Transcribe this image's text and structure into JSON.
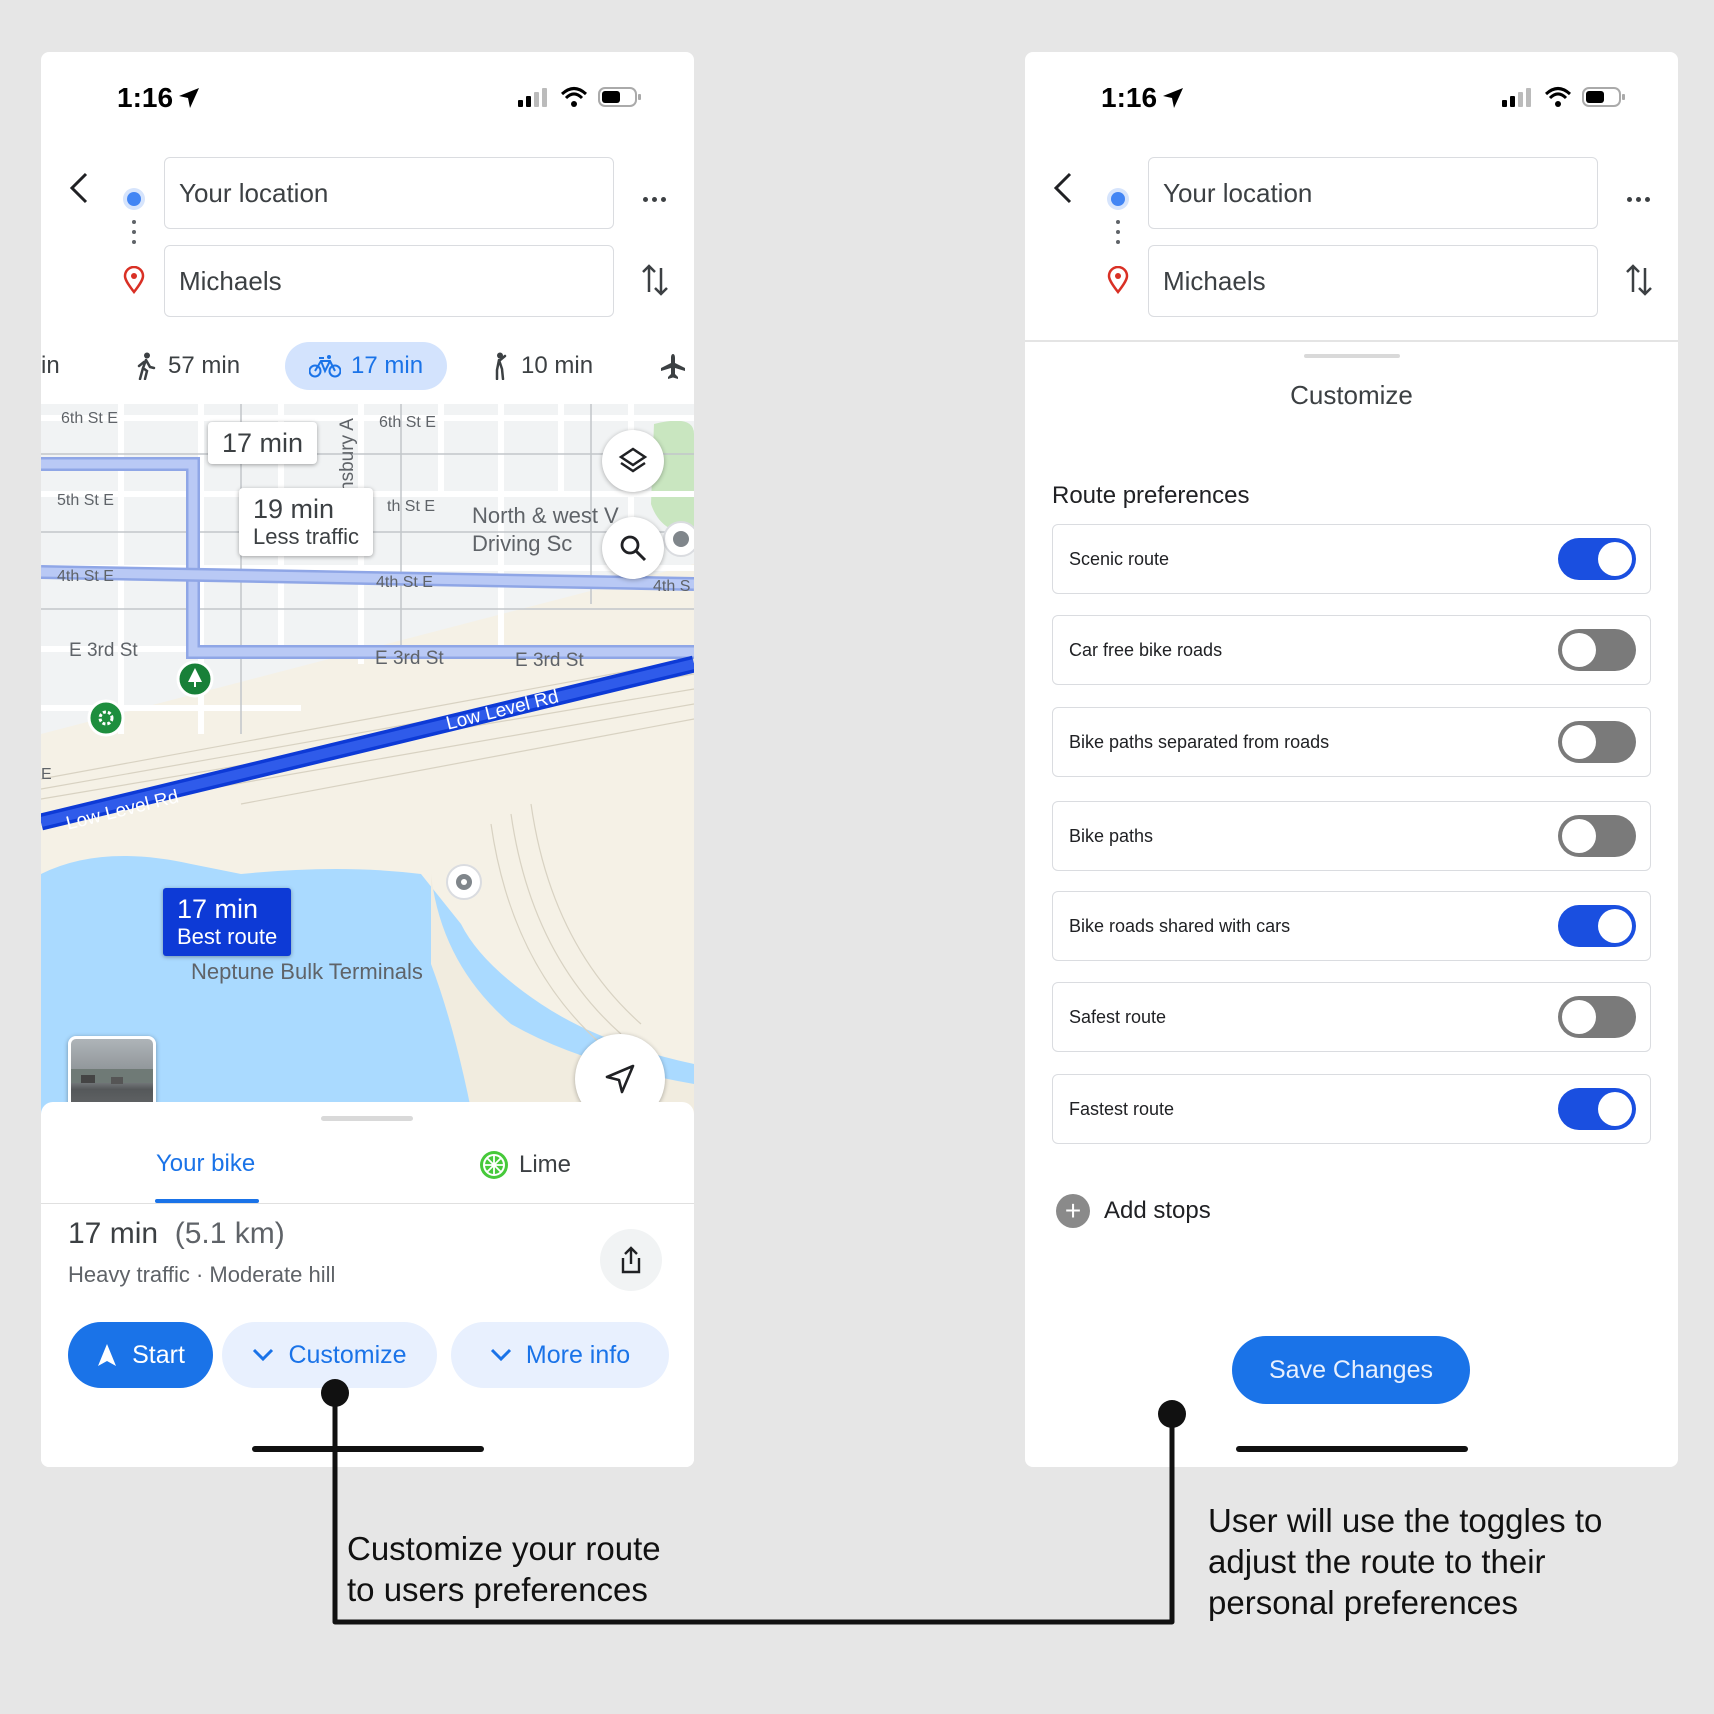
{
  "status_bar": {
    "time": "1:16"
  },
  "left_screen": {
    "origin": "Your location",
    "destination": "Michaels",
    "modes": [
      {
        "label": "in",
        "icon": "car-icon"
      },
      {
        "label": "57 min",
        "icon": "walk-icon"
      },
      {
        "label": "17 min",
        "icon": "bike-icon",
        "active": true
      },
      {
        "label": "10 min",
        "icon": "rideshare-icon"
      },
      {
        "label": "",
        "icon": "flight-icon"
      }
    ],
    "map": {
      "streets": [
        "6th St E",
        "6th St E",
        "5th St E",
        "th St E",
        "4th St E",
        "4th St E",
        "4th S",
        "E 3rd St",
        "E 3rd St",
        "E 3rd St",
        "Low Level Rd",
        "Low Level Rd",
        "nsbury A",
        "E"
      ],
      "callouts": [
        {
          "title": "17 min",
          "subtitle": ""
        },
        {
          "title": "19 min",
          "subtitle": "Less traffic"
        },
        {
          "title": "17 min",
          "subtitle": "Best route"
        }
      ],
      "poi_driving_school": "North & west V\nDriving Sc",
      "poi_terminals": "Neptune Bulk Terminals",
      "colors": {
        "best_route": "#0d3ad6",
        "alt_route": "#a9bdf3",
        "water": "#aadaff",
        "land": "#f5f1e6"
      }
    },
    "sheet": {
      "tabs": [
        {
          "label": "Your bike",
          "active": true
        },
        {
          "label": "Lime",
          "icon": "lime-icon"
        }
      ],
      "duration": "17 min",
      "distance": "(5.1 km)",
      "detail": "Heavy traffic · Moderate hill",
      "buttons": {
        "start": "Start",
        "customize": "Customize",
        "more_info": "More info"
      }
    }
  },
  "right_screen": {
    "origin": "Your location",
    "destination": "Michaels",
    "panel_title": "Customize",
    "prefs_heading": "Route preferences",
    "preferences": [
      {
        "label": "Scenic route",
        "on": true
      },
      {
        "label": "Car free bike roads",
        "on": false
      },
      {
        "label": "Bike paths separated from roads",
        "on": false
      },
      {
        "label": "Bike paths",
        "on": false
      },
      {
        "label": "Bike roads shared with cars",
        "on": true
      },
      {
        "label": "Safest route",
        "on": false
      },
      {
        "label": "Fastest route",
        "on": true
      }
    ],
    "add_stops": "Add stops",
    "save": "Save Changes",
    "colors": {
      "toggle_on": "#1a4fe0",
      "toggle_off": "#7a7a7a",
      "accent": "#1a73e8"
    }
  },
  "annotations": {
    "left_note": "Customize your route\nto users preferences",
    "right_note": "User will use the toggles to\nadjust the route to their\npersonal preferences"
  }
}
